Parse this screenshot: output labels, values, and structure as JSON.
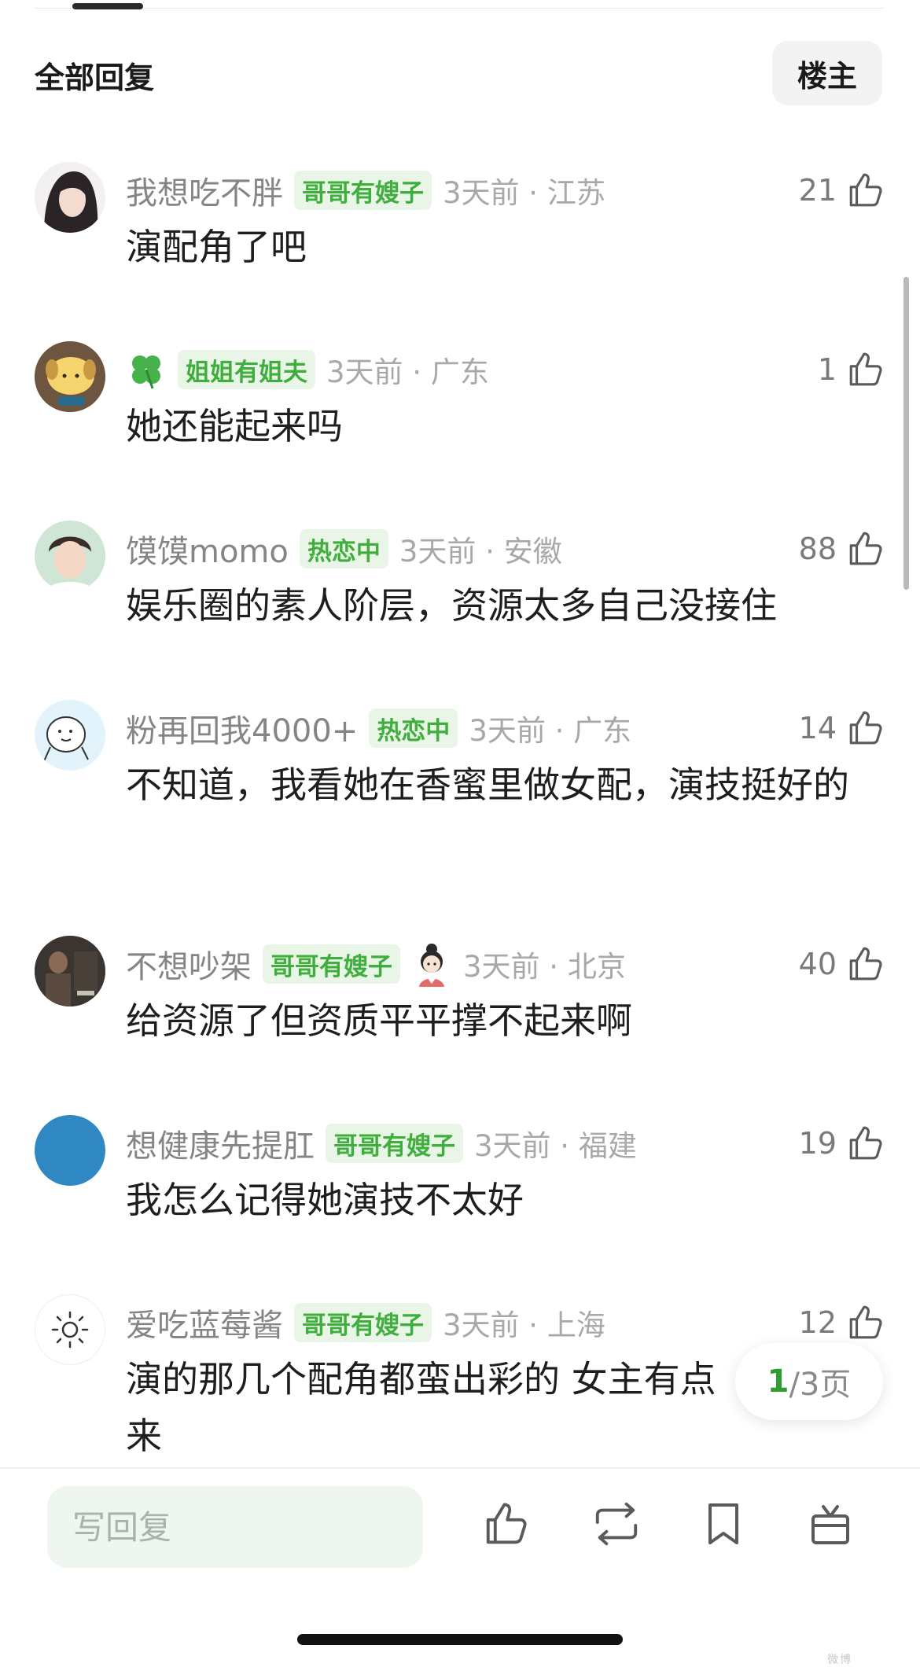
{
  "header": {
    "section_title": "全部回复",
    "owner_button": "楼主"
  },
  "comments": [
    {
      "username": "我想吃不胖",
      "badge": "哥哥有嫂子",
      "time": "3天前 · 江苏",
      "likes": "21",
      "text": "演配角了吧",
      "avatar": "woman-portrait-avatar"
    },
    {
      "username": "",
      "badge": "姐姐有姐夫",
      "time": "3天前 · 广东",
      "likes": "1",
      "text": "她还能起来吗",
      "avatar": "pudding-dog-avatar",
      "name_icon": "four-leaf-clover-icon"
    },
    {
      "username": "馍馍momo",
      "badge": "热恋中",
      "time": "3天前 · 安徽",
      "likes": "88",
      "text": "娱乐圈的素人阶层，资源太多自己没接住",
      "avatar": "young-man-portrait-avatar"
    },
    {
      "username": "粉再回我4000+",
      "badge": "热恋中",
      "time": "3天前 · 广东",
      "likes": "14",
      "text": "不知道，我看她在香蜜里做女配，演技挺好的",
      "avatar": "cartoon-face-avatar"
    },
    {
      "username": "不想吵架",
      "badge": "哥哥有嫂子",
      "time": "3天前 · 北京",
      "likes": "40",
      "text": "给资源了但资质平平撑不起来啊",
      "avatar": "dark-photo-avatar",
      "extra_icon": "girl-sticker-icon"
    },
    {
      "username": "想健康先提肛",
      "badge": "哥哥有嫂子",
      "time": "3天前 · 福建",
      "likes": "19",
      "text": "我怎么记得她演技不太好",
      "avatar": "blue-circle-avatar"
    },
    {
      "username": "爱吃蓝莓酱",
      "badge": "哥哥有嫂子",
      "time": "3天前 · 上海",
      "likes": "12",
      "text": "演的那几个配角都蛮出彩的 女主有点",
      "text_line2": "来",
      "avatar": "sun-icon-avatar"
    }
  ],
  "pagination": {
    "current": "1",
    "total_label": "/3页"
  },
  "bottom_bar": {
    "reply_placeholder": "写回复"
  },
  "watermark": "微博",
  "colors": {
    "badge_bg": "#e9f6e7",
    "badge_text": "#3fae3c",
    "accent_green": "#2f9e2f",
    "input_bg": "#eef6ef"
  }
}
